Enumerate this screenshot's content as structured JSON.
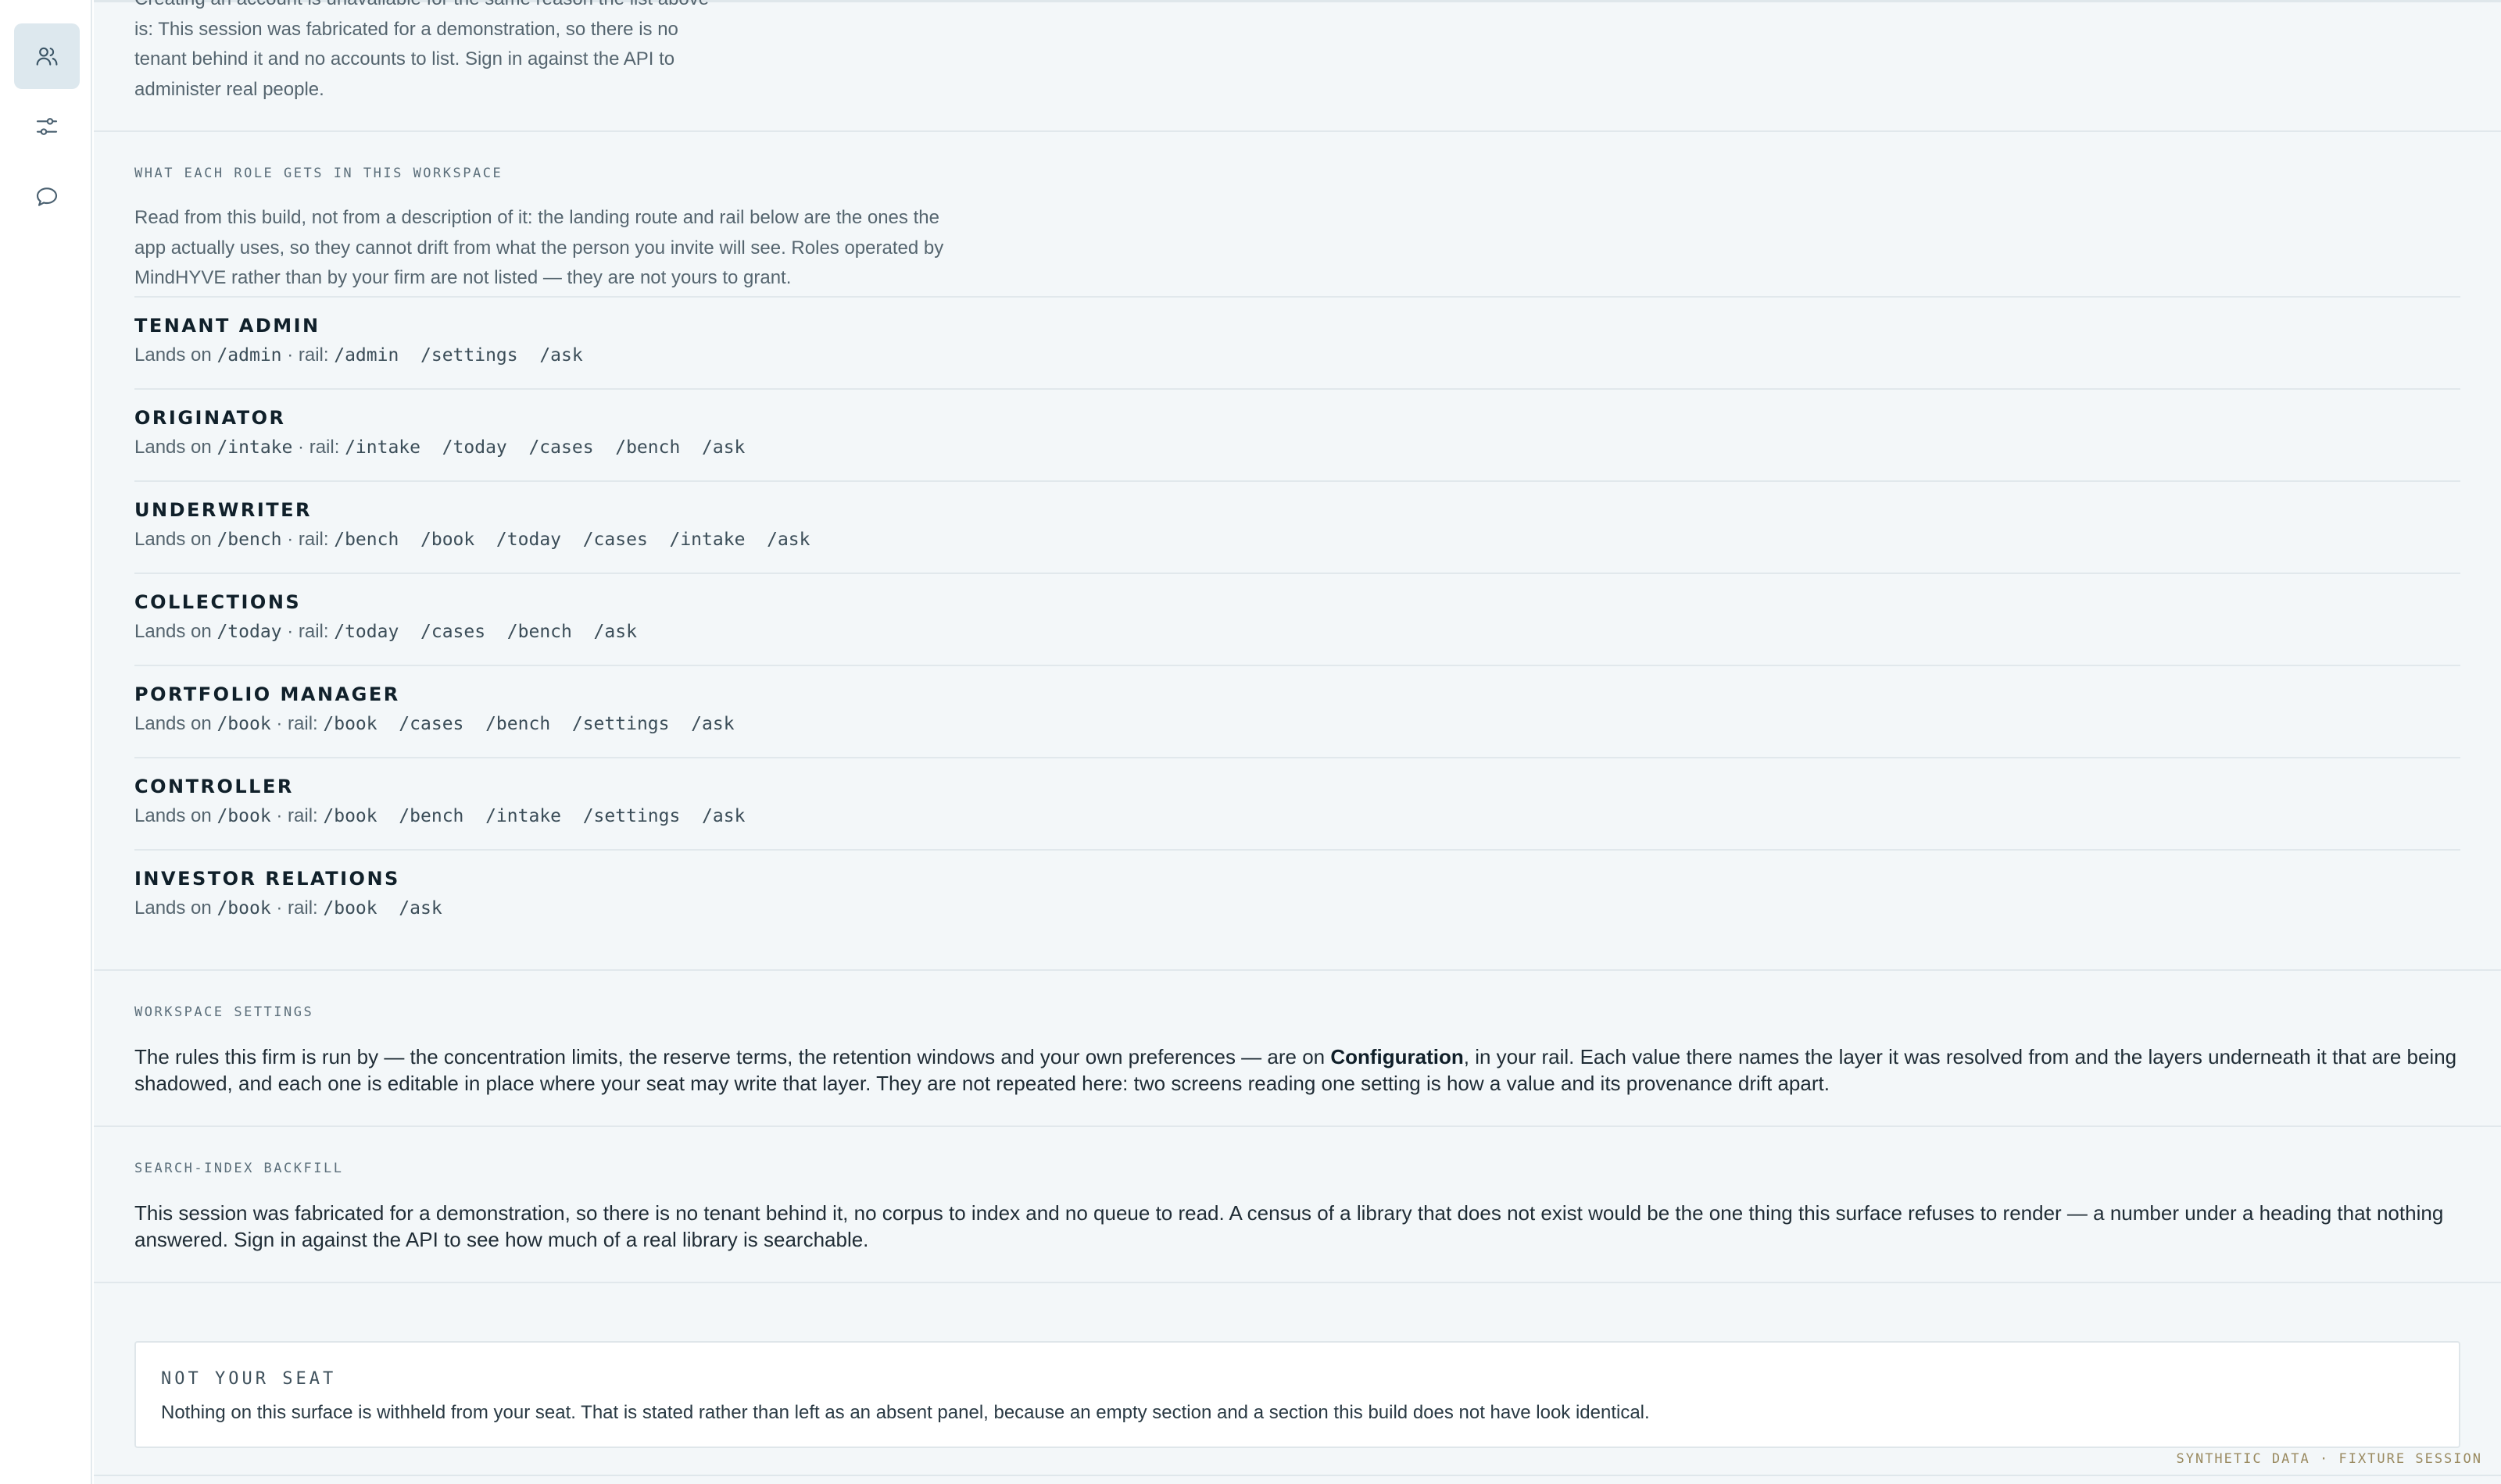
{
  "rail": {
    "items": [
      {
        "icon": "users-icon",
        "active": true
      },
      {
        "icon": "sliders-icon",
        "active": false
      },
      {
        "icon": "chat-bubble-icon",
        "active": false
      }
    ]
  },
  "account_notice": {
    "lines": [
      "Creating an account is unavailable for the same reason the list above",
      "is: This session was fabricated for a demonstration, so there is no",
      "tenant behind it and no accounts to list. Sign in against the API to",
      "administer real people."
    ]
  },
  "roles_section": {
    "heading": "WHAT EACH ROLE GETS IN THIS WORKSPACE",
    "intro_lines": [
      "Read from this build, not from a description of it: the landing route and rail below are the ones the",
      "app actually uses, so they cannot drift from what the person you invite will see. Roles operated by",
      "MindHYVE rather than by your firm are not listed — they are not yours to grant."
    ],
    "lands_on_label": "Lands on",
    "rail_label": "· rail:",
    "roles": [
      {
        "name": "TENANT ADMIN",
        "landing": "/admin",
        "rail": "/admin  /settings  /ask"
      },
      {
        "name": "ORIGINATOR",
        "landing": "/intake",
        "rail": "/intake  /today  /cases  /bench  /ask"
      },
      {
        "name": "UNDERWRITER",
        "landing": "/bench",
        "rail": "/bench  /book  /today  /cases  /intake  /ask"
      },
      {
        "name": "COLLECTIONS",
        "landing": "/today",
        "rail": "/today  /cases  /bench  /ask"
      },
      {
        "name": "PORTFOLIO MANAGER",
        "landing": "/book",
        "rail": "/book  /cases  /bench  /settings  /ask"
      },
      {
        "name": "CONTROLLER",
        "landing": "/book",
        "rail": "/book  /bench  /intake  /settings  /ask"
      },
      {
        "name": "INVESTOR RELATIONS",
        "landing": "/book",
        "rail": "/book  /ask"
      }
    ]
  },
  "workspace_settings": {
    "heading": "WORKSPACE SETTINGS",
    "text_before": "The rules this firm is run by — the concentration limits, the reserve terms, the retention windows and your own preferences — are on ",
    "link_label": "Configuration",
    "text_after_line1": ", in your rail. Each value there names the layer it was resolved from and the layers underneath it that are being",
    "line2": "shadowed, and each one is editable in place where your seat may write that layer. They are not repeated here: two screens reading one setting is how a value and its provenance drift apart."
  },
  "search_backfill": {
    "heading": "SEARCH-INDEX BACKFILL",
    "line1": "This session was fabricated for a demonstration, so there is no tenant behind it, no corpus to index and no queue to read. A census of a library that does not exist would be the one thing this surface refuses to render — a number under a heading that nothing",
    "line2": "answered. Sign in against the API to see how much of a real library is searchable."
  },
  "not_your_seat": {
    "title": "NOT YOUR SEAT",
    "text": "Nothing on this surface is withheld from your seat. That is stated rather than left as an absent panel, because an empty section and a section this build does not have look identical."
  },
  "footer": {
    "tag": "SYNTHETIC DATA · FIXTURE SESSION"
  }
}
